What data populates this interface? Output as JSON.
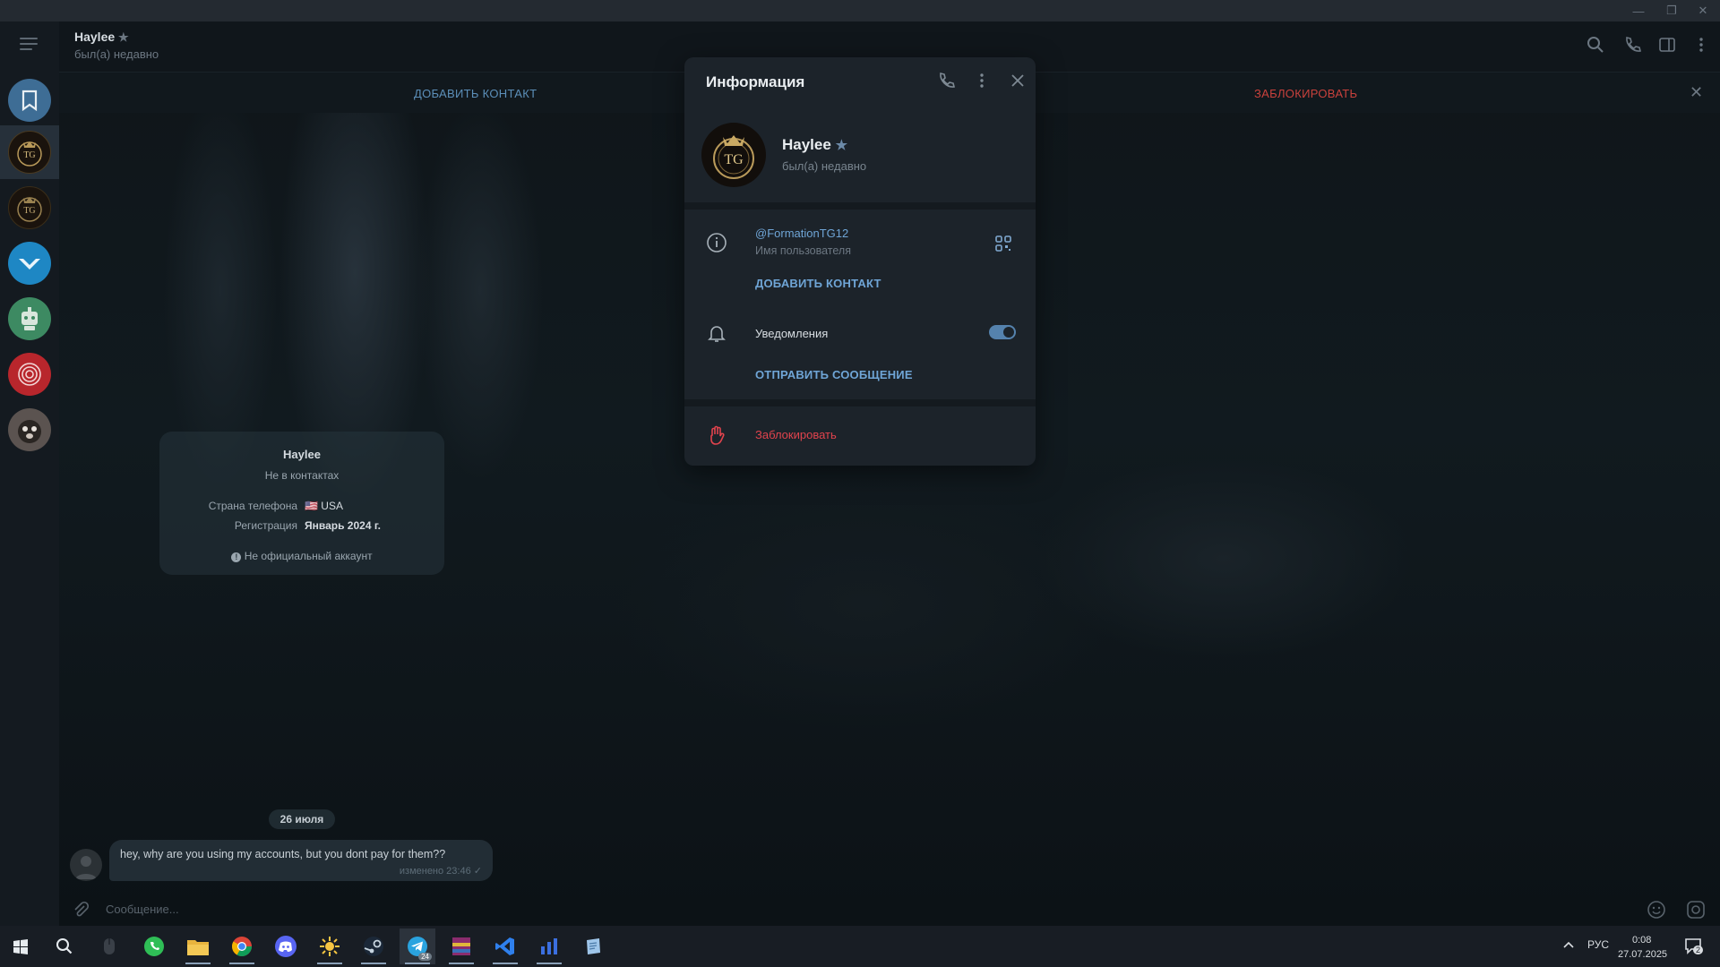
{
  "window": {
    "controls": [
      "minimize-icon",
      "restore-icon",
      "close-icon"
    ]
  },
  "chat": {
    "name": "Haylee",
    "status": "был(а) недавно",
    "actions": {
      "add_contact": "ДОБАВИТЬ КОНТАКТ",
      "block": "ЗАБЛОКИРОВАТЬ"
    }
  },
  "info_card": {
    "name": "Haylee",
    "subtitle": "Не в контактах",
    "rows": [
      {
        "key": "Страна телефона",
        "flag": "🇺🇸",
        "value": "USA"
      },
      {
        "key": "Регистрация",
        "value": "Январь 2024 г."
      }
    ],
    "official_note": "Не официальный аккаунт"
  },
  "messages": {
    "date_chip": "26 июля",
    "items": [
      {
        "text": "hey, why are you using my accounts, but you dont pay for them??",
        "meta": "изменено 23:46",
        "status_icon": "check-icon"
      }
    ]
  },
  "composer": {
    "placeholder": "Сообщение..."
  },
  "info_modal": {
    "title": "Информация",
    "name": "Haylee",
    "status": "был(а) недавно",
    "username": "@FormationTG12",
    "username_label": "Имя пользователя",
    "add_contact": "ДОБАВИТЬ КОНТАКТ",
    "notifications_label": "Уведомления",
    "notifications_on": true,
    "send_message": "ОТПРАВИТЬ СООБЩЕНИЕ",
    "block": "Заблокировать",
    "accent": "#6fa5d6",
    "danger": "#e0434d"
  },
  "taskbar": {
    "apps": [
      "windows-start-icon",
      "search-icon",
      "mouse-icon",
      "whatsapp-icon",
      "file-explorer-icon",
      "chrome-icon",
      "discord-icon",
      "sun-app-icon",
      "steam-icon",
      "telegram-icon",
      "winrar-icon",
      "vscode-icon",
      "chart-app-icon",
      "notes-app-icon"
    ],
    "telegram_badge": "24",
    "lang": "РУС",
    "time": "0:08",
    "date": "27.07.2025",
    "notif_count": "2"
  }
}
